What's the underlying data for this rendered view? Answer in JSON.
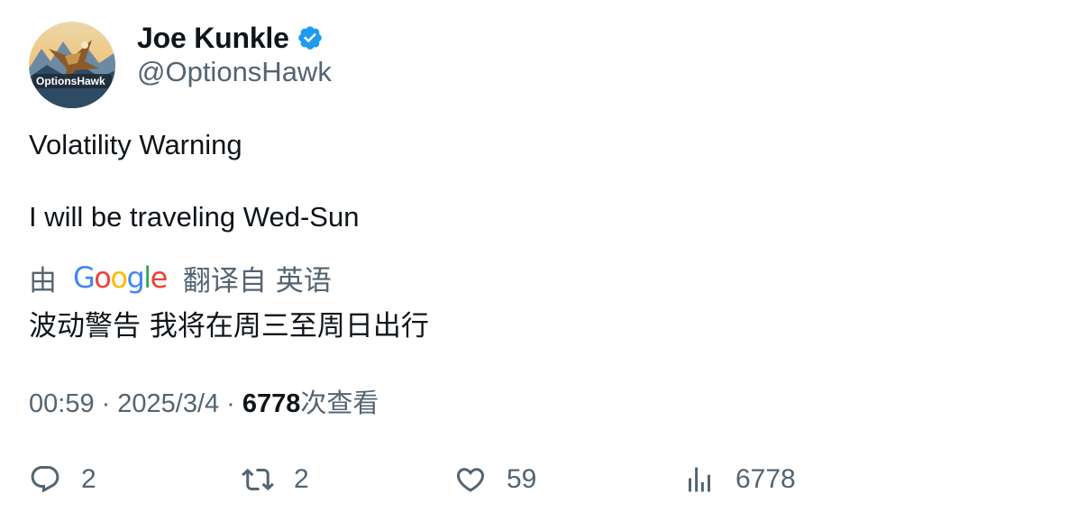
{
  "author": {
    "display_name": "Joe Kunkle",
    "handle": "@OptionsHawk",
    "verified": true,
    "avatar_text": "OptionsHawk"
  },
  "tweet": {
    "lines": [
      "Volatility Warning",
      "I will be traveling Wed-Sun"
    ]
  },
  "translation": {
    "prefix": "由",
    "provider": "Google",
    "suffix": "翻译自 英语",
    "text": "波动警告 我将在周三至周日出行"
  },
  "meta": {
    "time": "00:59",
    "separator": "·",
    "date": "2025/3/4",
    "views_count": "6778",
    "views_label": "次查看"
  },
  "actions": {
    "reply_count": "2",
    "retweet_count": "2",
    "like_count": "59",
    "views_count": "6778"
  },
  "colors": {
    "text_primary": "#0f1419",
    "text_secondary": "#536471",
    "verified_badge": "#1d9bf0"
  }
}
